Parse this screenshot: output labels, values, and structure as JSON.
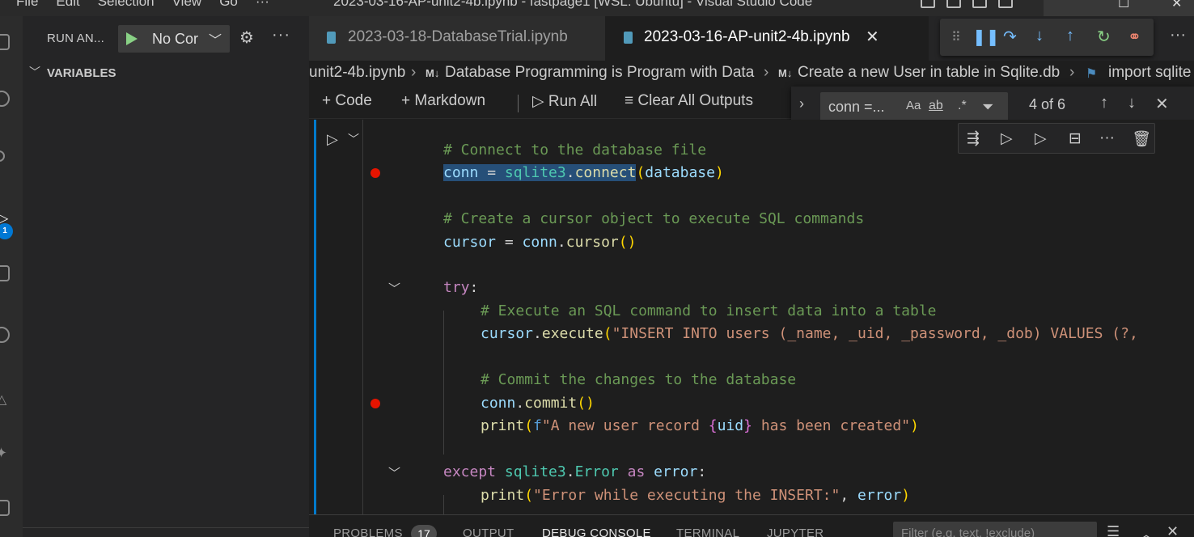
{
  "titlebar": {
    "menu": [
      "File",
      "Edit",
      "Selection",
      "View",
      "Go",
      "···"
    ],
    "window_title": "2023-03-16-AP-unit2-4b.ipynb - fastpage1 [WSL: Ubuntu] - Visual Studio Code"
  },
  "activity": {
    "badge": "1"
  },
  "sidebar": {
    "title": "RUN AN...",
    "launch_config": "No Cor",
    "more": "···",
    "section": "VARIABLES"
  },
  "tabs": [
    {
      "label": "2023-03-18-DatabaseTrial.ipynb",
      "active": false
    },
    {
      "label": "2023-03-16-AP-unit2-4b.ipynb",
      "active": true
    }
  ],
  "tabs_more": "···",
  "breadcrumb": {
    "file": "unit2-4b.ipynb",
    "md_marker": "M↓",
    "items": [
      "Database Programming is Program with Data",
      "Create a new User in table in Sqlite.db",
      "import sqlite"
    ]
  },
  "notebook_toolbar": {
    "code": "Code",
    "markdown": "Markdown",
    "run_all": "Run All",
    "clear_outputs": "Clear All Outputs"
  },
  "find": {
    "value": "conn =...",
    "match_case": "Aa",
    "whole_word": "ab",
    "regex": ".*",
    "count": "4 of 6"
  },
  "code_lines": {
    "l1_comment": "# Connect to the database file",
    "l2_conn": "conn",
    "l2_eq": " = ",
    "l2_mod": "sqlite3",
    "l2_dot": ".",
    "l2_fn": "connect",
    "l2_open": "(",
    "l2_arg": "database",
    "l2_close": ")",
    "l4_comment": "# Create a cursor object to execute SQL commands",
    "l5_var": "cursor",
    "l5_eq": " = ",
    "l5_obj": "conn",
    "l5_dot": ".",
    "l5_fn": "cursor",
    "l5_paren": "()",
    "l7_kw": "try",
    "l7_colon": ":",
    "l8_comment": "# Execute an SQL command to insert data into a table",
    "l9_obj": "cursor",
    "l9_dot": ".",
    "l9_fn": "execute",
    "l9_open": "(",
    "l9_str": "\"INSERT INTO users (_name, _uid, _password, _dob) VALUES (?,",
    "l11_comment": "# Commit the changes to the database",
    "l12_obj": "conn",
    "l12_dot": ".",
    "l12_fn": "commit",
    "l12_paren": "()",
    "l13_fn": "print",
    "l13_open": "(",
    "l13_fpre": "f",
    "l13_str1": "\"A new user record ",
    "l13_bopen": "{",
    "l13_var": "uid",
    "l13_bclose": "}",
    "l13_str2": " has been created\"",
    "l13_close": ")",
    "l15_kw": "except",
    "l15_sp": " ",
    "l15_mod": "sqlite3",
    "l15_dot": ".",
    "l15_ty": "Error",
    "l15_as": " as ",
    "l15_var": "error",
    "l15_colon": ":",
    "l16_fn": "print",
    "l16_open": "(",
    "l16_str": "\"Error while executing the INSERT:\"",
    "l16_comma": ", ",
    "l16_var": "error",
    "l16_close": ")"
  },
  "panel": {
    "tabs": [
      "PROBLEMS",
      "OUTPUT",
      "DEBUG CONSOLE",
      "TERMINAL",
      "JUPYTER"
    ],
    "problems_count": "17",
    "filter_placeholder": "Filter (e.g. text, !exclude)"
  },
  "colors": {
    "accent": "#007acc",
    "breakpoint": "#e51400",
    "run_green": "#89d185",
    "selection": "#264f78"
  }
}
